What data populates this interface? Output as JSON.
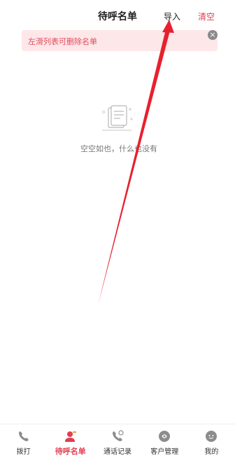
{
  "header": {
    "title": "待呼名单",
    "import_label": "导入",
    "clear_label": "清空"
  },
  "tip": {
    "text": "左滑列表可删除名单",
    "close_icon": "close-icon"
  },
  "empty_state": {
    "icon": "empty-document-icon",
    "text": "空空如也，什么也没有"
  },
  "tabbar": {
    "items": [
      {
        "label": "拨打",
        "icon": "phone-icon",
        "active": false
      },
      {
        "label": "待呼名单",
        "icon": "contact-list-icon",
        "active": true
      },
      {
        "label": "通话记录",
        "icon": "call-log-icon",
        "active": false
      },
      {
        "label": "客户管理",
        "icon": "customer-icon",
        "active": false
      },
      {
        "label": "我的",
        "icon": "profile-icon",
        "active": false
      }
    ]
  },
  "colors": {
    "accent": "#e23d52",
    "tip_background": "#fde7e8",
    "annotation_arrow": "#e8202e"
  }
}
